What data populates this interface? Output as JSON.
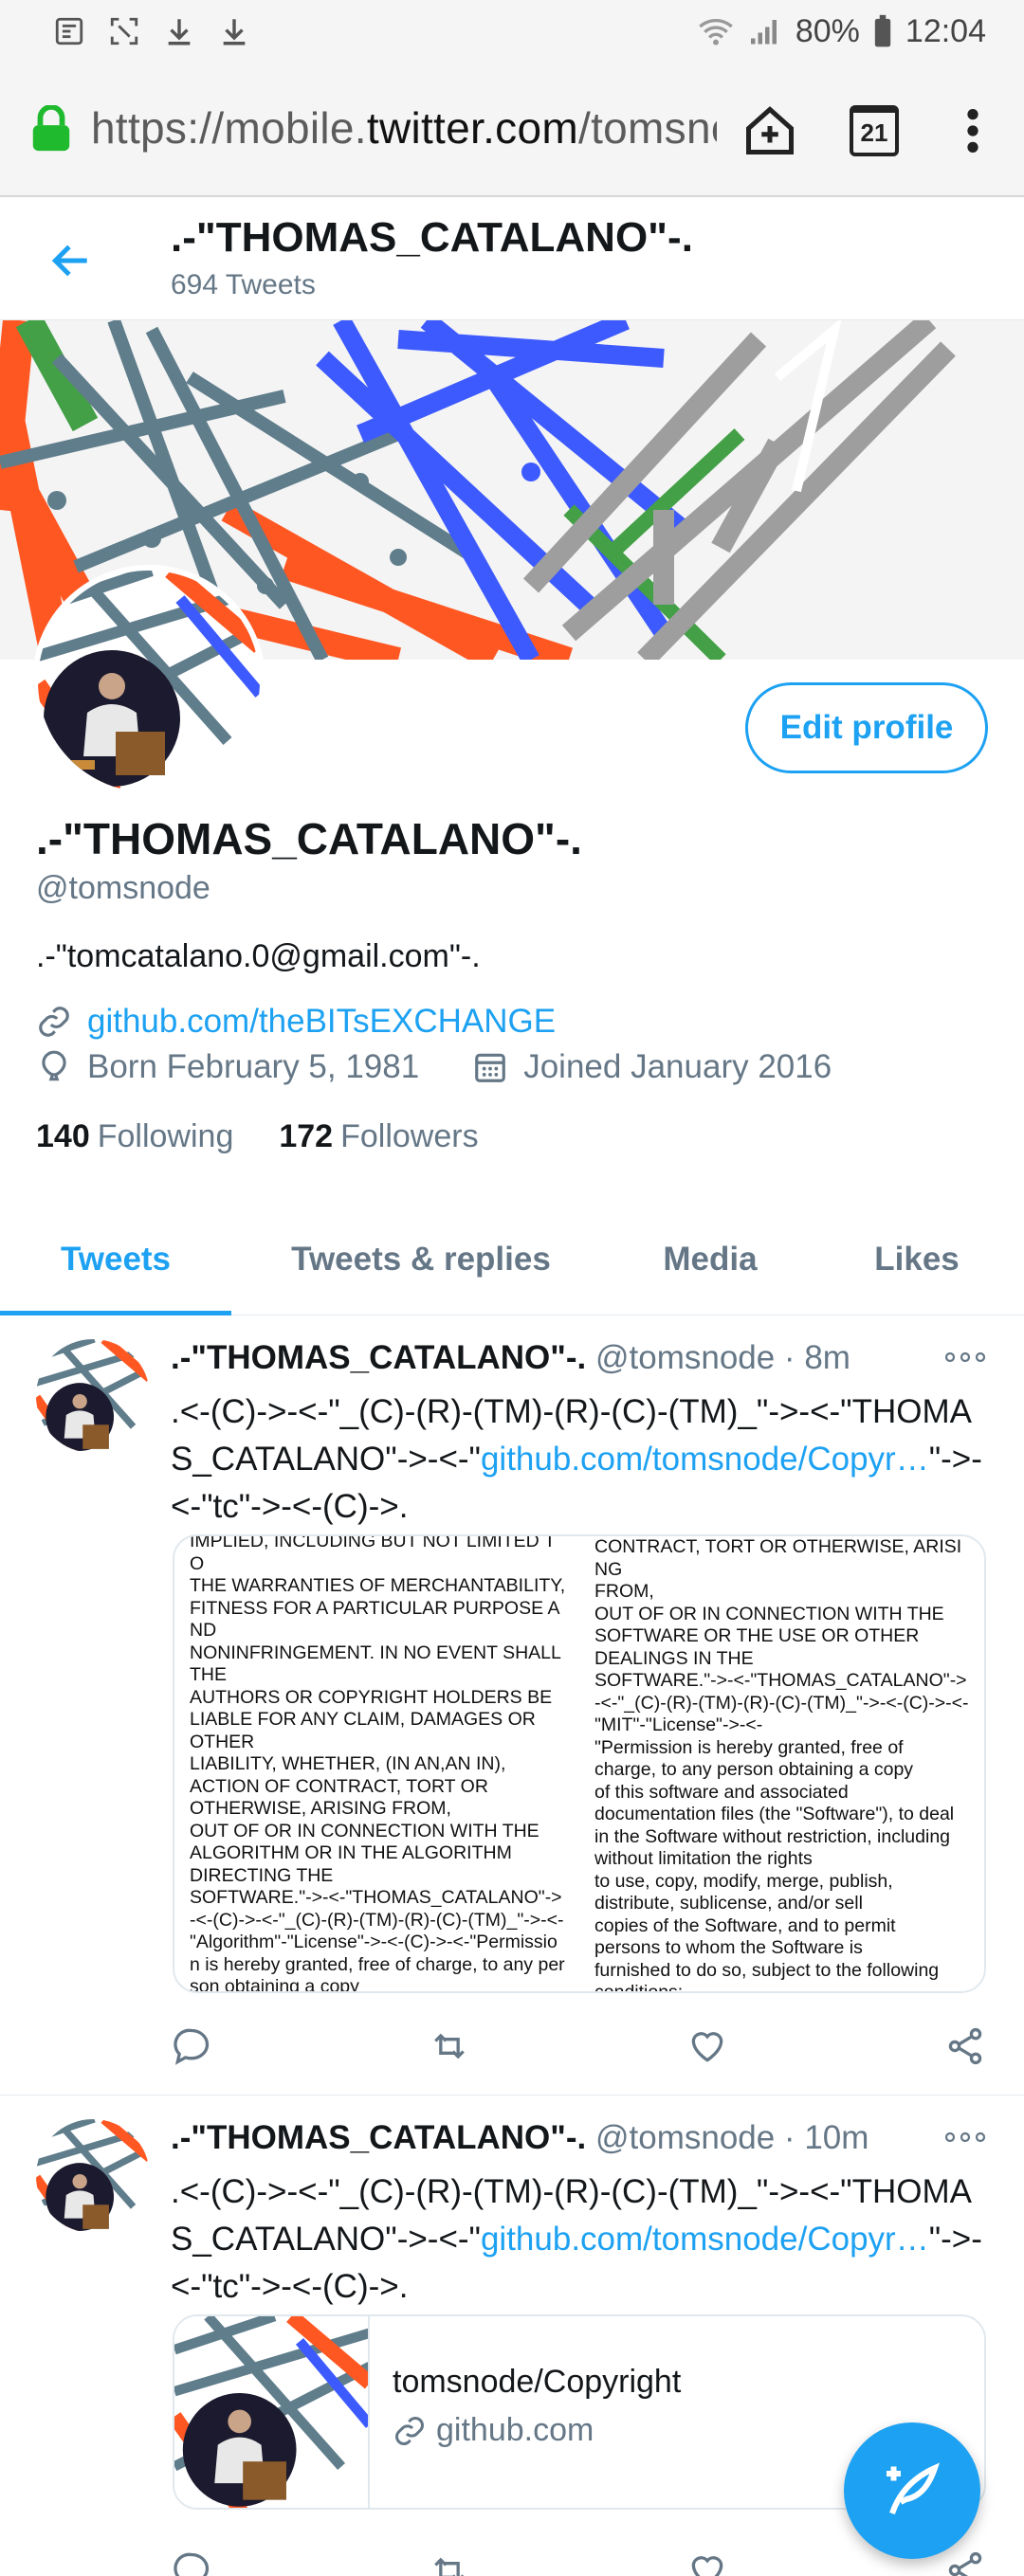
{
  "status_bar": {
    "battery": "80%",
    "time": "12:04"
  },
  "browser": {
    "url_prefix": "https://mobile.",
    "url_host": "twitter.com",
    "url_rest": "/tomsnode",
    "tab_count": "21"
  },
  "header": {
    "name": ".-\"THOMAS_CATALANO\"-.",
    "tweet_count": "694 Tweets"
  },
  "profile": {
    "edit_label": "Edit profile",
    "name": ".-\"THOMAS_CATALANO\"-.",
    "handle": "@tomsnode",
    "bio": ".-\"tomcatalano.0@gmail.com\"-.",
    "website": "github.com/theBITsEXCHANGE",
    "born": "Born February 5, 1981",
    "joined": "Joined January 2016",
    "following_count": "140",
    "following_label": "Following",
    "followers_count": "172",
    "followers_label": "Followers"
  },
  "tabs": [
    {
      "label": "Tweets"
    },
    {
      "label": "Tweets & replies"
    },
    {
      "label": "Media"
    },
    {
      "label": "Likes"
    }
  ],
  "tweets": [
    {
      "name": ".-\"THOMAS_CATALANO\"-.",
      "handle_time": " @tomsnode · 8m",
      "text_a": ".<-(C)->-<-\"_(C)-(R)-(TM)-(R)-(C)-(TM)_\"->-<-\"THOMAS_CATALANO\"->-<-\"",
      "link": "github.com/tomsnode/Copyr…",
      "text_b": "\"->-<-\"tc\"->-<-(C)->.",
      "media_left": "IMPLIED, INCLUDING BUT NOT LIMITED TO\nTHE WARRANTIES OF MERCHANTABILITY,\nFITNESS FOR A PARTICULAR PURPOSE AND\nNONINFRINGEMENT. IN NO EVENT SHALL\nTHE\nAUTHORS OR COPYRIGHT HOLDERS BE\nLIABLE FOR ANY CLAIM, DAMAGES OR\nOTHER\nLIABILITY, WHETHER, (IN AN,AN IN),\nACTION OF CONTRACT, TORT OR\nOTHERWISE, ARISING FROM,\nOUT OF OR IN CONNECTION WITH THE\nALGORITHM OR IN THE ALGORITHM\nDIRECTING THE\nSOFTWARE.\"->-<-\"THOMAS_CATALANO\"->-<-(C)->-<-\"_(C)-(R)-(TM)-(R)-(C)-(TM)_\"->-<-\"Algorithm\"-\"License\"->-<-(C)->-<-\"Permission is hereby granted, free of charge, to any person obtaining a copy\n\"of this algorithm and associated\n\"documentation files\" (this",
      "media_right": "CONTRACT, TORT OR OTHERWISE, ARISING\nFROM,\nOUT OF OR IN CONNECTION WITH THE\nSOFTWARE OR THE USE OR OTHER\nDEALINGS IN THE\nSOFTWARE.\"->-<-\"THOMAS_CATALANO\"->-<-\"_(C)-(R)-(TM)-(R)-(C)-(TM)_\"->-<-(C)->-<-\"MIT\"-\"License\"->-<-\n\"Permission is hereby granted, free of\ncharge, to any person obtaining a copy\nof this software and associated\ndocumentation files (the \"Software\"), to deal\nin the Software without restriction, including\nwithout limitation the rights\nto use, copy, modify, merge, publish,\ndistribute, sublicense, and/or sell\ncopies of the Software, and to permit\npersons to whom the Software is\nfurnished to do so, subject to the following\nconditions:"
    },
    {
      "name": ".-\"THOMAS_CATALANO\"-.",
      "handle_time": " @tomsnode · 10m",
      "text_a": ".<-(C)->-<-\"_(C)-(R)-(TM)-(R)-(C)-(TM)_\"->-<-\"THOMAS_CATALANO\"->-<-\"",
      "link": "github.com/tomsnode/Copyr…",
      "text_b": "\"->-<-\"tc\"->-<-(C)->.",
      "card_title": "tomsnode/Copyright",
      "card_domain": "github.com"
    }
  ],
  "icons": {
    "lock": "lock-icon",
    "back": "back-arrow-icon",
    "link": "link-icon",
    "birthday": "balloon-icon",
    "calendar": "calendar-icon",
    "reply": "reply-icon",
    "retweet": "retweet-icon",
    "like": "heart-icon",
    "share": "share-icon",
    "compose": "compose-feather-icon"
  },
  "colors": {
    "accent": "#1da1f2",
    "secondary_text": "#657786",
    "lock_green": "#1fba2d"
  }
}
